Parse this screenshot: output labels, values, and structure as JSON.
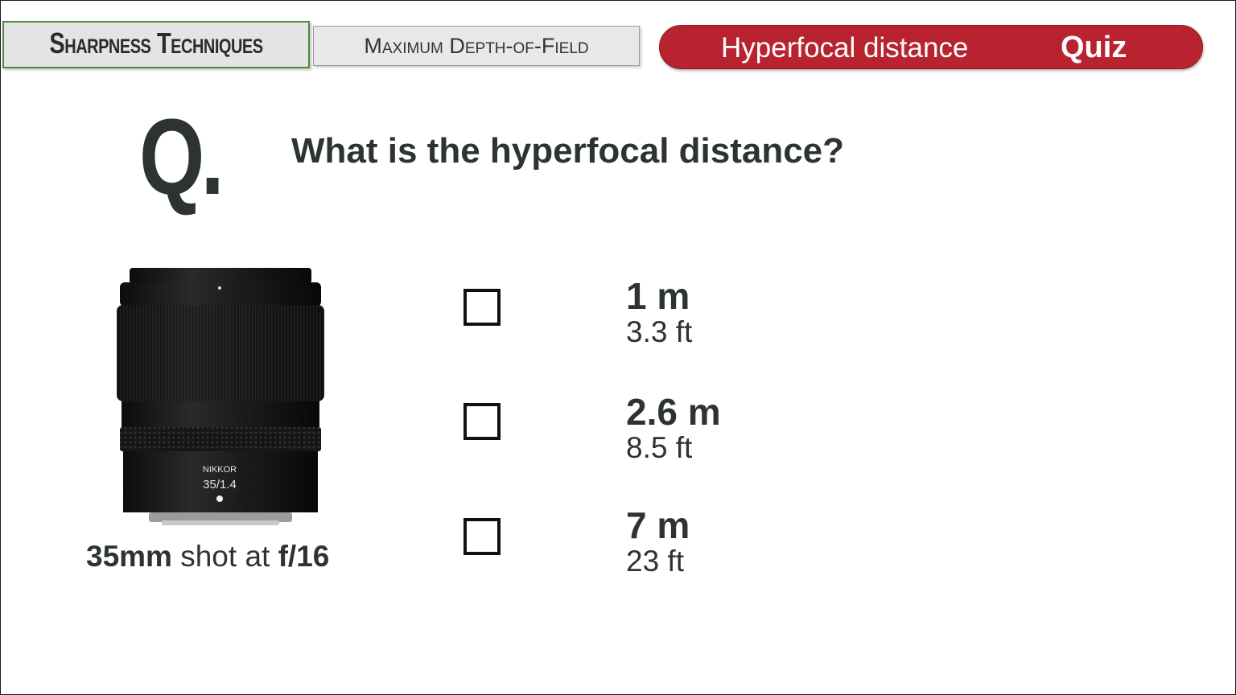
{
  "header": {
    "section_title": "Sharpness Techniques",
    "subsection_title": "Maximum Depth-of-Field",
    "topic": "Hyperfocal distance",
    "badge": "Quiz"
  },
  "question": {
    "marker": "Q.",
    "text": "What is the hyperfocal distance?"
  },
  "lens": {
    "brand": "NIKKOR",
    "spec": "35/1.4",
    "caption_focal": "35mm",
    "caption_mid": " shot at ",
    "caption_aperture": "f/16"
  },
  "options": [
    {
      "metric": "1 m",
      "imperial": "3.3 ft"
    },
    {
      "metric": "2.6 m",
      "imperial": "8.5 ft"
    },
    {
      "metric": "7 m",
      "imperial": "23 ft"
    }
  ],
  "colors": {
    "accent_red": "#b8232f",
    "tab_border_green": "#4e8a3e",
    "text_dark": "#2d3333"
  }
}
